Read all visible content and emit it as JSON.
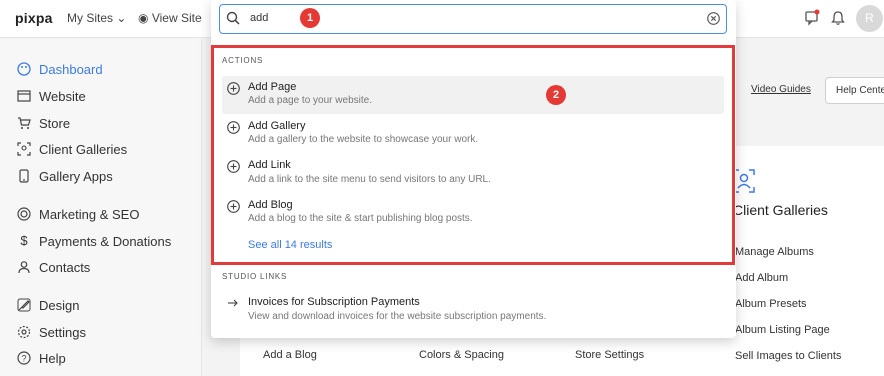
{
  "topbar": {
    "logo": "pixpa",
    "my_sites": "My Sites",
    "view_site": "View Site",
    "avatar_initial": "R"
  },
  "sidebar": {
    "items": [
      {
        "label": "Dashboard",
        "icon": "palette-icon",
        "active": true
      },
      {
        "label": "Website",
        "icon": "website-icon"
      },
      {
        "label": "Store",
        "icon": "cart-icon"
      },
      {
        "label": "Client Galleries",
        "icon": "client-galleries-icon"
      },
      {
        "label": "Gallery Apps",
        "icon": "mobile-icon"
      },
      {
        "label": "Marketing & SEO",
        "icon": "target-icon"
      },
      {
        "label": "Payments & Donations",
        "icon": "dollar-icon"
      },
      {
        "label": "Contacts",
        "icon": "user-icon"
      },
      {
        "label": "Design",
        "icon": "design-icon"
      },
      {
        "label": "Settings",
        "icon": "gear-icon"
      },
      {
        "label": "Help",
        "icon": "help-icon"
      }
    ]
  },
  "main": {
    "video_guides": "Video Guides",
    "help_center": "Help Center",
    "client_galleries": {
      "title": "Client Galleries",
      "links": [
        "Manage Albums",
        "Add Album",
        "Album Presets",
        "Album Listing Page",
        "Sell Images to Clients"
      ]
    },
    "bottom_links": [
      "Add a Blog",
      "Colors & Spacing",
      "Store Settings"
    ]
  },
  "search": {
    "value": "add",
    "actions_label": "ACTIONS",
    "actions": [
      {
        "title": "Add Page",
        "desc": "Add a page to your website."
      },
      {
        "title": "Add Gallery",
        "desc": "Add a gallery to the website to showcase your work."
      },
      {
        "title": "Add Link",
        "desc": "Add a link to the site menu to send visitors to any URL."
      },
      {
        "title": "Add Blog",
        "desc": "Add a blog to the site & start publishing blog posts."
      }
    ],
    "see_all": "See all 14 results",
    "studio_links_label": "STUDIO LINKS",
    "studio_links": [
      {
        "title": "Invoices for Subscription Payments",
        "desc": "View and download invoices for the website subscription payments."
      }
    ]
  },
  "annotations": {
    "badge_1": "1",
    "badge_2": "2"
  },
  "colors": {
    "accent": "#3d7be0",
    "highlight": "#e23b3b",
    "badge": "#e53935"
  }
}
